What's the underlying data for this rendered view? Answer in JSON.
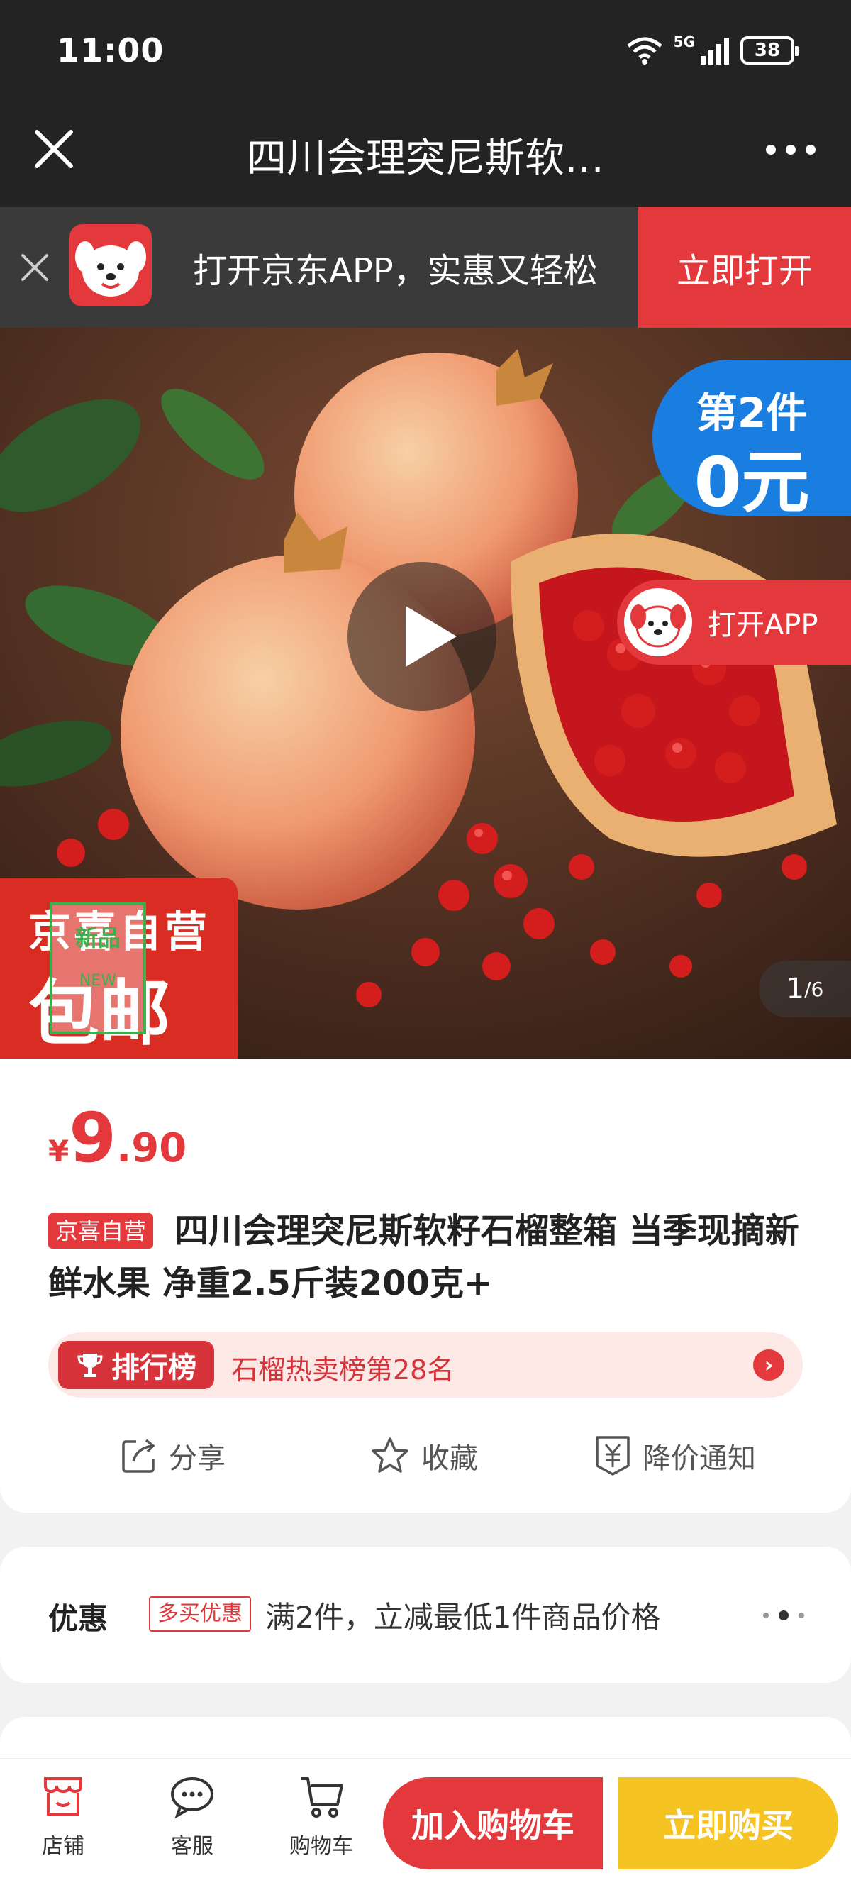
{
  "status_bar": {
    "time": "11:00",
    "network": "5G",
    "battery": "38"
  },
  "nav": {
    "title": "四川会理突尼斯软…"
  },
  "app_banner": {
    "text": "打开京东APP，实惠又轻松",
    "open_button": "立即打开"
  },
  "hero": {
    "promo_line1": "第2件",
    "promo_line2": "0元",
    "open_app": "打开APP",
    "corner_line1": "京喜自营",
    "corner_line2": "包邮",
    "new_stamp_line1": "新品",
    "new_stamp_line2": "NEW",
    "page_current": "1",
    "page_total": "/6"
  },
  "product": {
    "price_symbol": "¥",
    "price_int": "9",
    "price_dec": ".90",
    "tag": "京喜自营",
    "title": "四川会理突尼斯软籽石榴整箱 当季现摘新鲜水果 净重2.5斤装200克+",
    "rank_label": "排行榜",
    "rank_text": "石榴热卖榜第28名",
    "rank_arrow": "›"
  },
  "actions": {
    "share": "分享",
    "favorite": "收藏",
    "price_alert": "降价通知"
  },
  "promo": {
    "label": "优惠",
    "tag": "多买优惠",
    "text": "满2件，立减最低1件商品价格"
  },
  "bottom_bar": {
    "store": "店铺",
    "service": "客服",
    "cart": "购物车",
    "add_to_cart": "加入购物车",
    "buy_now": "立即购买"
  },
  "colors": {
    "accent": "#e4393c",
    "buy": "#f5c422",
    "promo_badge": "#1a7de0",
    "dark": "#232323"
  }
}
